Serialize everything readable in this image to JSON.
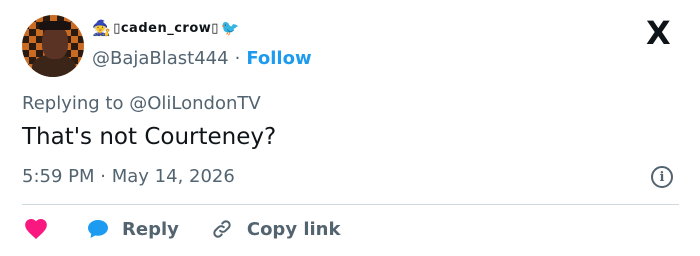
{
  "user": {
    "display_name": "␣caden␣crow␣",
    "display_name_emoji_left": "🔮",
    "display_name_emoji_right": "🐦‍⬛",
    "handle": "@BajaBlast444",
    "separator": "·",
    "follow_label": "Follow"
  },
  "logo": {
    "text": "X"
  },
  "tweet": {
    "replying_prefix": "Replying to",
    "replying_to": "@OliLondonTV",
    "text": "That's not Courteney?",
    "time": "5:59 PM",
    "date_separator": "·",
    "date": "May 14, 2026"
  },
  "actions": {
    "reply_label": "Reply",
    "copy_link_label": "Copy link"
  },
  "colors": {
    "accent": "#1d9bf0",
    "heart": "#f91880",
    "secondary_text": "#536471"
  }
}
